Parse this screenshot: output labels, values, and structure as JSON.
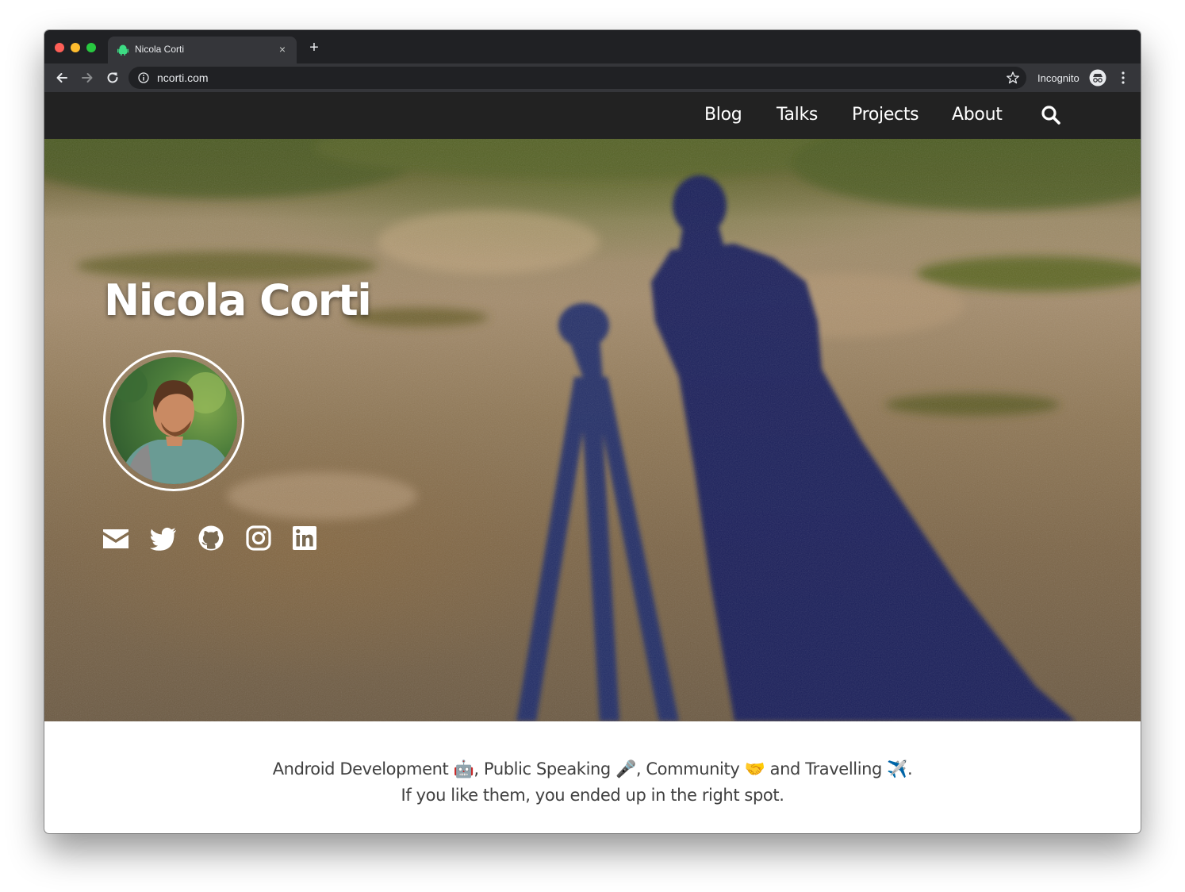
{
  "browser": {
    "tab_title": "Nicola Corti",
    "url": "ncorti.com",
    "incognito_label": "Incognito",
    "new_tab_label": "+",
    "close_label": "×"
  },
  "nav": {
    "items": [
      {
        "label": "Blog"
      },
      {
        "label": "Talks"
      },
      {
        "label": "Projects"
      },
      {
        "label": "About"
      }
    ]
  },
  "hero": {
    "title": "Nicola Corti",
    "socials": [
      "email-icon",
      "twitter-icon",
      "github-icon",
      "instagram-icon",
      "linkedin-icon"
    ]
  },
  "tagline": {
    "line1": "Android Development 🤖, Public Speaking 🎤, Community 🤝 and Travelling ✈️.",
    "line2": "If you like them, you ended up in the right spot."
  },
  "colors": {
    "chrome_dark": "#202124",
    "chrome_toolbar": "#35363a",
    "site_nav": "#222222",
    "text": "#404040"
  }
}
